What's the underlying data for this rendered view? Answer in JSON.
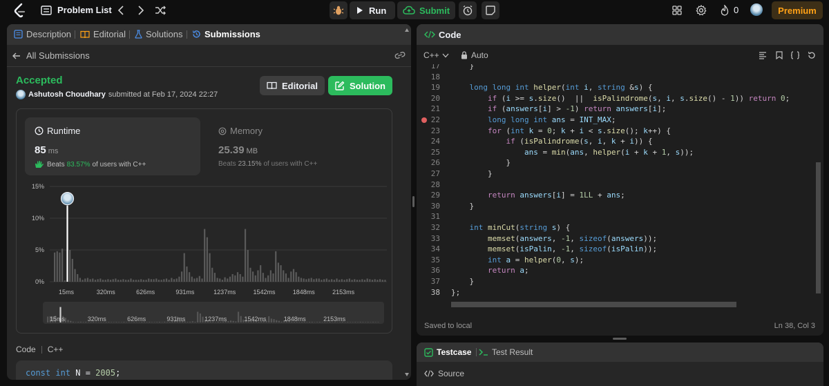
{
  "topbar": {
    "problem_list_label": "Problem List",
    "run_label": "Run",
    "submit_label": "Submit",
    "streak_count": "0",
    "premium_label": "Premium"
  },
  "left_tabs": [
    {
      "label": "Description",
      "icon": "document-icon"
    },
    {
      "label": "Editorial",
      "icon": "book-icon"
    },
    {
      "label": "Solutions",
      "icon": "flask-icon"
    },
    {
      "label": "Submissions",
      "icon": "history-icon",
      "active": true
    }
  ],
  "submission": {
    "back_label": "All Submissions",
    "status": "Accepted",
    "author": "Ashutosh Choudhary",
    "submitted_text": "submitted at Feb 17, 2024 22:27",
    "editorial_label": "Editorial",
    "solution_label": "Solution",
    "runtime": {
      "title": "Runtime",
      "value": "85",
      "unit": "ms",
      "beats_prefix": "Beats",
      "beats_pct": "83.57%",
      "beats_suffix": "of users with C++"
    },
    "memory": {
      "title": "Memory",
      "value": "25.39",
      "unit": "MB",
      "beats_prefix": "Beats",
      "beats_pct": "23.15%",
      "beats_suffix": "of users with C++"
    },
    "code_label": "Code",
    "code_lang": "C++",
    "code_preview": {
      "kw1": "const",
      "kw2": "int",
      "rest": " N = ",
      "num": "2005",
      "end": ";"
    }
  },
  "chart_data": {
    "type": "bar",
    "y_ticks": [
      "15%",
      "10%",
      "5%",
      "0%"
    ],
    "ylim": [
      0,
      15
    ],
    "x_tick_labels": [
      "15ms",
      "320ms",
      "626ms",
      "931ms",
      "1237ms",
      "1542ms",
      "1848ms",
      "2153ms"
    ],
    "highlight_bin": 5,
    "values": [
      4.6,
      4.8,
      4.6,
      5.2,
      0.2,
      12,
      5.0,
      3.6,
      2.0,
      1.2,
      0.6,
      0.3,
      0.5,
      0.6,
      0.4,
      0.5,
      0.3,
      0.4,
      0.5,
      0.3,
      0.3,
      0.4,
      0.3,
      0.4,
      0.5,
      0.3,
      0.3,
      0.4,
      0.3,
      0.3,
      0.5,
      0.3,
      0.3,
      0.3,
      0.4,
      0.3,
      0.3,
      0.5,
      0.4,
      0.4,
      0.5,
      0.3,
      0.3,
      0.4,
      0.5,
      0.3,
      0.6,
      0.4,
      0.5,
      0.8,
      1.6,
      4.5,
      2.4,
      1.5,
      0.8,
      0.5,
      0.6,
      0.9,
      0.5,
      8.3,
      7.0,
      4.5,
      2.2,
      1.4,
      0.6,
      0.5,
      0.3,
      0.7,
      0.5,
      0.8,
      1.2,
      1.0,
      1.5,
      1.2,
      0.8,
      8.3,
      5.0,
      2.2,
      1.6,
      1.0,
      1.8,
      2.6,
      1.4,
      0.6,
      1.0,
      1.8,
      1.3,
      4.8,
      3.0,
      2.6,
      1.8,
      1.3,
      0.6,
      1.6,
      2.0,
      1.5,
      0.8,
      0.6,
      0.5,
      0.4,
      0.5,
      0.6,
      0.4,
      0.5,
      0.5,
      0.3,
      0.4,
      0.5,
      0.3,
      0.4,
      0.3,
      0.5,
      0.3,
      0.4,
      0.3,
      0.4,
      0.5,
      0.3,
      0.4,
      0.3,
      0.3,
      0.4,
      0.3,
      0.5,
      0.4,
      0.3,
      0.4,
      0.3,
      0.4,
      0.3,
      0.3
    ]
  },
  "code_panel": {
    "title": "Code",
    "language": "C++",
    "mode": "Auto",
    "saved_text": "Saved to local",
    "cursor_pos": "Ln 38, Col 3",
    "lines": [
      {
        "n": "17",
        "t": [
          {
            "c": "plain",
            "s": "    }"
          }
        ]
      },
      {
        "n": "18",
        "t": []
      },
      {
        "n": "19",
        "t": [
          {
            "c": "plain",
            "s": "    "
          },
          {
            "c": "kw",
            "s": "long long int"
          },
          {
            "c": "plain",
            "s": " "
          },
          {
            "c": "fn",
            "s": "helper"
          },
          {
            "c": "plain",
            "s": "("
          },
          {
            "c": "kw",
            "s": "int"
          },
          {
            "c": "plain",
            "s": " "
          },
          {
            "c": "var",
            "s": "i"
          },
          {
            "c": "plain",
            "s": ", "
          },
          {
            "c": "kw",
            "s": "string"
          },
          {
            "c": "plain",
            "s": " &"
          },
          {
            "c": "var",
            "s": "s"
          },
          {
            "c": "plain",
            "s": ") {"
          }
        ]
      },
      {
        "n": "20",
        "t": [
          {
            "c": "plain",
            "s": "        "
          },
          {
            "c": "ctl",
            "s": "if"
          },
          {
            "c": "plain",
            "s": " ("
          },
          {
            "c": "var",
            "s": "i"
          },
          {
            "c": "plain",
            "s": " >= "
          },
          {
            "c": "var",
            "s": "s"
          },
          {
            "c": "plain",
            "s": "."
          },
          {
            "c": "fn",
            "s": "size"
          },
          {
            "c": "plain",
            "s": "()  ||  "
          },
          {
            "c": "fn",
            "s": "isPalindrome"
          },
          {
            "c": "plain",
            "s": "("
          },
          {
            "c": "var",
            "s": "s"
          },
          {
            "c": "plain",
            "s": ", "
          },
          {
            "c": "var",
            "s": "i"
          },
          {
            "c": "plain",
            "s": ", "
          },
          {
            "c": "var",
            "s": "s"
          },
          {
            "c": "plain",
            "s": "."
          },
          {
            "c": "fn",
            "s": "size"
          },
          {
            "c": "plain",
            "s": "() - "
          },
          {
            "c": "num",
            "s": "1"
          },
          {
            "c": "plain",
            "s": ")) "
          },
          {
            "c": "ctl",
            "s": "return"
          },
          {
            "c": "plain",
            "s": " "
          },
          {
            "c": "num",
            "s": "0"
          },
          {
            "c": "plain",
            "s": ";"
          }
        ]
      },
      {
        "n": "21",
        "t": [
          {
            "c": "plain",
            "s": "        "
          },
          {
            "c": "ctl",
            "s": "if"
          },
          {
            "c": "plain",
            "s": " ("
          },
          {
            "c": "var",
            "s": "answers"
          },
          {
            "c": "plain",
            "s": "["
          },
          {
            "c": "var",
            "s": "i"
          },
          {
            "c": "plain",
            "s": "] > "
          },
          {
            "c": "num",
            "s": "-1"
          },
          {
            "c": "plain",
            "s": ") "
          },
          {
            "c": "ctl",
            "s": "return"
          },
          {
            "c": "plain",
            "s": " "
          },
          {
            "c": "var",
            "s": "answers"
          },
          {
            "c": "plain",
            "s": "["
          },
          {
            "c": "var",
            "s": "i"
          },
          {
            "c": "plain",
            "s": "];"
          }
        ]
      },
      {
        "n": "22",
        "t": [
          {
            "c": "plain",
            "s": "        "
          },
          {
            "c": "kw",
            "s": "long long int"
          },
          {
            "c": "plain",
            "s": " "
          },
          {
            "c": "var",
            "s": "ans"
          },
          {
            "c": "plain",
            "s": " = "
          },
          {
            "c": "var",
            "s": "INT_MAX"
          },
          {
            "c": "plain",
            "s": ";"
          }
        ]
      },
      {
        "n": "23",
        "t": [
          {
            "c": "plain",
            "s": "        "
          },
          {
            "c": "ctl",
            "s": "for"
          },
          {
            "c": "plain",
            "s": " ("
          },
          {
            "c": "kw",
            "s": "int"
          },
          {
            "c": "plain",
            "s": " "
          },
          {
            "c": "var",
            "s": "k"
          },
          {
            "c": "plain",
            "s": " = "
          },
          {
            "c": "num",
            "s": "0"
          },
          {
            "c": "plain",
            "s": "; "
          },
          {
            "c": "var",
            "s": "k"
          },
          {
            "c": "plain",
            "s": " + "
          },
          {
            "c": "var",
            "s": "i"
          },
          {
            "c": "plain",
            "s": " < "
          },
          {
            "c": "var",
            "s": "s"
          },
          {
            "c": "plain",
            "s": "."
          },
          {
            "c": "fn",
            "s": "size"
          },
          {
            "c": "plain",
            "s": "(); "
          },
          {
            "c": "var",
            "s": "k"
          },
          {
            "c": "plain",
            "s": "++) {"
          }
        ]
      },
      {
        "n": "24",
        "t": [
          {
            "c": "plain",
            "s": "            "
          },
          {
            "c": "ctl",
            "s": "if"
          },
          {
            "c": "plain",
            "s": " ("
          },
          {
            "c": "fn",
            "s": "isPalindrome"
          },
          {
            "c": "plain",
            "s": "("
          },
          {
            "c": "var",
            "s": "s"
          },
          {
            "c": "plain",
            "s": ", "
          },
          {
            "c": "var",
            "s": "i"
          },
          {
            "c": "plain",
            "s": ", "
          },
          {
            "c": "var",
            "s": "k"
          },
          {
            "c": "plain",
            "s": " + "
          },
          {
            "c": "var",
            "s": "i"
          },
          {
            "c": "plain",
            "s": ")) {"
          }
        ]
      },
      {
        "n": "25",
        "t": [
          {
            "c": "plain",
            "s": "                "
          },
          {
            "c": "var",
            "s": "ans"
          },
          {
            "c": "plain",
            "s": " = "
          },
          {
            "c": "fn",
            "s": "min"
          },
          {
            "c": "plain",
            "s": "("
          },
          {
            "c": "var",
            "s": "ans"
          },
          {
            "c": "plain",
            "s": ", "
          },
          {
            "c": "fn",
            "s": "helper"
          },
          {
            "c": "plain",
            "s": "("
          },
          {
            "c": "var",
            "s": "i"
          },
          {
            "c": "plain",
            "s": " + "
          },
          {
            "c": "var",
            "s": "k"
          },
          {
            "c": "plain",
            "s": " + "
          },
          {
            "c": "num",
            "s": "1"
          },
          {
            "c": "plain",
            "s": ", "
          },
          {
            "c": "var",
            "s": "s"
          },
          {
            "c": "plain",
            "s": "));"
          }
        ]
      },
      {
        "n": "26",
        "t": [
          {
            "c": "plain",
            "s": "            }"
          }
        ]
      },
      {
        "n": "27",
        "t": [
          {
            "c": "plain",
            "s": "        }"
          }
        ]
      },
      {
        "n": "28",
        "t": []
      },
      {
        "n": "29",
        "t": [
          {
            "c": "plain",
            "s": "        "
          },
          {
            "c": "ctl",
            "s": "return"
          },
          {
            "c": "plain",
            "s": " "
          },
          {
            "c": "var",
            "s": "answers"
          },
          {
            "c": "plain",
            "s": "["
          },
          {
            "c": "var",
            "s": "i"
          },
          {
            "c": "plain",
            "s": "] = "
          },
          {
            "c": "num",
            "s": "1LL"
          },
          {
            "c": "plain",
            "s": " + "
          },
          {
            "c": "var",
            "s": "ans"
          },
          {
            "c": "plain",
            "s": ";"
          }
        ]
      },
      {
        "n": "30",
        "t": [
          {
            "c": "plain",
            "s": "    }"
          }
        ]
      },
      {
        "n": "31",
        "t": []
      },
      {
        "n": "32",
        "t": [
          {
            "c": "plain",
            "s": "    "
          },
          {
            "c": "kw",
            "s": "int"
          },
          {
            "c": "plain",
            "s": " "
          },
          {
            "c": "fn",
            "s": "minCut"
          },
          {
            "c": "plain",
            "s": "("
          },
          {
            "c": "kw",
            "s": "string"
          },
          {
            "c": "plain",
            "s": " "
          },
          {
            "c": "var",
            "s": "s"
          },
          {
            "c": "plain",
            "s": ") {"
          }
        ]
      },
      {
        "n": "33",
        "t": [
          {
            "c": "plain",
            "s": "        "
          },
          {
            "c": "fn",
            "s": "memset"
          },
          {
            "c": "plain",
            "s": "("
          },
          {
            "c": "var",
            "s": "answers"
          },
          {
            "c": "plain",
            "s": ", "
          },
          {
            "c": "num",
            "s": "-1"
          },
          {
            "c": "plain",
            "s": ", "
          },
          {
            "c": "kw",
            "s": "sizeof"
          },
          {
            "c": "plain",
            "s": "("
          },
          {
            "c": "var",
            "s": "answers"
          },
          {
            "c": "plain",
            "s": "));"
          }
        ]
      },
      {
        "n": "34",
        "t": [
          {
            "c": "plain",
            "s": "        "
          },
          {
            "c": "fn",
            "s": "memset"
          },
          {
            "c": "plain",
            "s": "("
          },
          {
            "c": "var",
            "s": "isPalin"
          },
          {
            "c": "plain",
            "s": ", "
          },
          {
            "c": "num",
            "s": "-1"
          },
          {
            "c": "plain",
            "s": ", "
          },
          {
            "c": "kw",
            "s": "sizeof"
          },
          {
            "c": "plain",
            "s": "("
          },
          {
            "c": "var",
            "s": "isPalin"
          },
          {
            "c": "plain",
            "s": "));"
          }
        ]
      },
      {
        "n": "35",
        "t": [
          {
            "c": "plain",
            "s": "        "
          },
          {
            "c": "kw",
            "s": "int"
          },
          {
            "c": "plain",
            "s": " "
          },
          {
            "c": "var",
            "s": "a"
          },
          {
            "c": "plain",
            "s": " = "
          },
          {
            "c": "fn",
            "s": "helper"
          },
          {
            "c": "plain",
            "s": "("
          },
          {
            "c": "num",
            "s": "0"
          },
          {
            "c": "plain",
            "s": ", "
          },
          {
            "c": "var",
            "s": "s"
          },
          {
            "c": "plain",
            "s": ");"
          }
        ]
      },
      {
        "n": "36",
        "t": [
          {
            "c": "plain",
            "s": "        "
          },
          {
            "c": "ctl",
            "s": "return"
          },
          {
            "c": "plain",
            "s": " "
          },
          {
            "c": "var",
            "s": "a"
          },
          {
            "c": "plain",
            "s": ";"
          }
        ]
      },
      {
        "n": "37",
        "t": [
          {
            "c": "plain",
            "s": "    }"
          }
        ]
      },
      {
        "n": "38",
        "t": [
          {
            "c": "plain",
            "s": "};"
          }
        ]
      }
    ]
  },
  "test_panel": {
    "testcase_label": "Testcase",
    "result_label": "Test Result",
    "source_label": "Source"
  },
  "colors": {
    "accent_green": "#2cbb5d",
    "premium_orange": "#ffa116",
    "panel_bg": "#262626",
    "editor_bg": "#1e1e1e"
  }
}
